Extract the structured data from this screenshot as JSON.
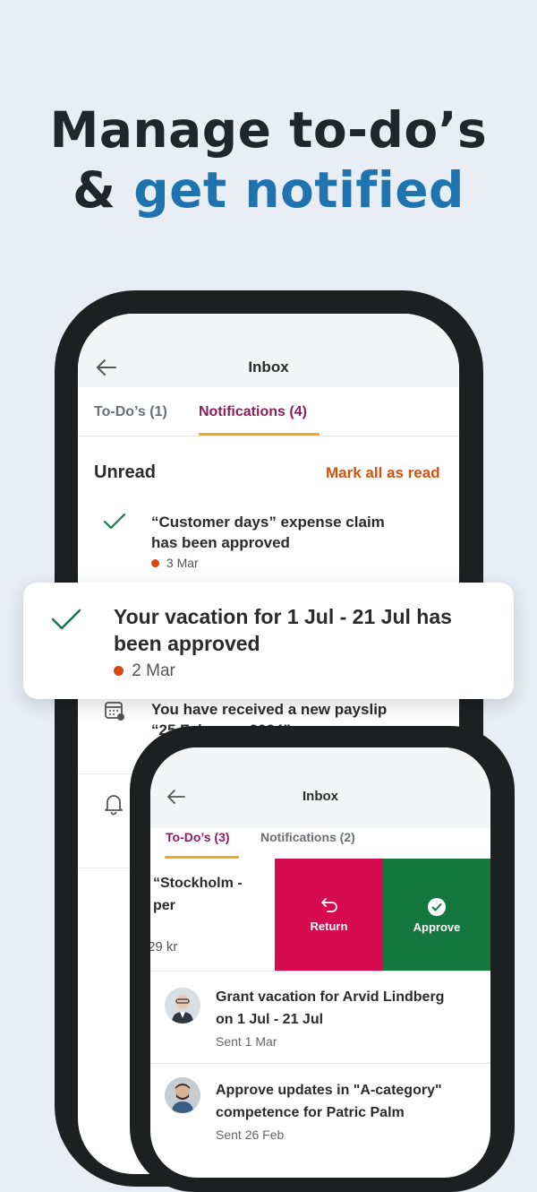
{
  "headline": {
    "line1": "Manage to-do’s",
    "line2_prefix": "& ",
    "line2_accent": "get notified"
  },
  "colors": {
    "background": "#e9eef5",
    "accent_blue": "#1f74b0",
    "tab_active": "#8a1e5e",
    "tab_underline": "#f0a81c",
    "mark_read": "#d4510e",
    "check_green": "#1a7a4c",
    "return_red": "#d60b4f",
    "approve_green": "#14773f",
    "unread_dot": "#d94812"
  },
  "phone_back": {
    "title": "Inbox",
    "tabs": [
      {
        "label": "To-Do’s (1)",
        "active": false
      },
      {
        "label": "Notifications (4)",
        "active": true
      }
    ],
    "section_title": "Unread",
    "mark_all_label": "Mark all as read",
    "items": [
      {
        "icon": "check-icon",
        "title_line1": "“Customer days” expense claim",
        "title_line2": "has been approved",
        "date": "3 Mar",
        "unread": true
      },
      {
        "icon": "payslip-calendar-icon",
        "title_line1": "You have received a new payslip",
        "title_line2": "“25 February 2024”"
      },
      {
        "icon": "bell-icon"
      }
    ]
  },
  "floating_card": {
    "icon": "check-icon",
    "title_line1": "Your vacation for 1 Jul - 21 Jul has",
    "title_line2": "been approved",
    "date": "2 Mar",
    "unread": true
  },
  "phone_front": {
    "title": "Inbox",
    "tabs": [
      {
        "label": "To-Do’s (3)",
        "active": true
      },
      {
        "label": "Notifications (2)",
        "active": false
      }
    ],
    "swiped_item": {
      "text_line1": "“Stockholm -",
      "text_line2": "per",
      "amount": "29 kr"
    },
    "actions": [
      {
        "label": "Return",
        "icon": "return-arrow-icon"
      },
      {
        "label": "Approve",
        "icon": "check-circle-icon"
      }
    ],
    "items": [
      {
        "title_line1": "Grant vacation for Arvid Lindberg",
        "title_line2": "on 1 Jul - 21 Jul",
        "meta": "Sent 1 Mar",
        "avatar": "person-avatar-1"
      },
      {
        "title_line1": "Approve updates in \"A-category\"",
        "title_line2": "competence for Patric Palm",
        "meta": "Sent 26 Feb",
        "avatar": "person-avatar-2"
      }
    ]
  }
}
